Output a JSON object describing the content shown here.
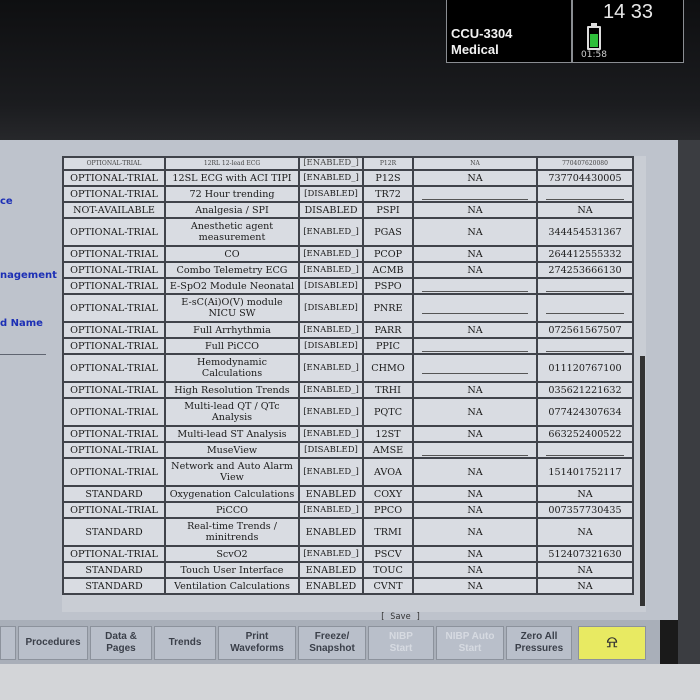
{
  "status": {
    "bed_label": "CCU-3304",
    "unit_label": "Medical",
    "time": "14 33",
    "battery_remaining": "01:58",
    "battery_color": "#2ebf3a"
  },
  "left_labels": [
    "ce",
    "nagement",
    "d Name"
  ],
  "options": [
    {
      "status": "OPTIONAL-TRIAL",
      "name": "12RL 12-lead ECG",
      "state": "[ENABLED_]",
      "code": "P12R",
      "tfa": "NA",
      "serial": "770407620080",
      "partial": true
    },
    {
      "status": "OPTIONAL-TRIAL",
      "name": "12SL ECG with ACI TIPI",
      "state": "[ENABLED_]",
      "code": "P12S",
      "tfa": "NA",
      "serial": "737704430005"
    },
    {
      "status": "OPTIONAL-TRIAL",
      "name": "72 Hour trending",
      "state": "[DISABLED]",
      "code": "TR72",
      "tfa": "",
      "serial": ""
    },
    {
      "status": "NOT-AVAILABLE",
      "name": "Analgesia / SPI",
      "state": "DISABLED",
      "code": "PSPI",
      "tfa": "NA",
      "serial": "NA"
    },
    {
      "status": "OPTIONAL-TRIAL",
      "name": "Anesthetic agent measurement",
      "state": "[ENABLED_]",
      "code": "PGAS",
      "tfa": "NA",
      "serial": "344454531367",
      "tall": true
    },
    {
      "status": "OPTIONAL-TRIAL",
      "name": "CO",
      "state": "[ENABLED_]",
      "code": "PCOP",
      "tfa": "NA",
      "serial": "264412555332"
    },
    {
      "status": "OPTIONAL-TRIAL",
      "name": "Combo Telemetry ECG",
      "state": "[ENABLED_]",
      "code": "ACMB",
      "tfa": "NA",
      "serial": "274253666130"
    },
    {
      "status": "OPTIONAL-TRIAL",
      "name": "E-SpO2 Module Neonatal",
      "state": "[DISABLED]",
      "code": "PSPO",
      "tfa": "",
      "serial": ""
    },
    {
      "status": "OPTIONAL-TRIAL",
      "name": "E-sC(Ai)O(V) module NICU SW",
      "state": "[DISABLED]",
      "code": "PNRE",
      "tfa": "",
      "serial": "",
      "tall": true
    },
    {
      "status": "OPTIONAL-TRIAL",
      "name": "Full Arrhythmia",
      "state": "[ENABLED_]",
      "code": "PARR",
      "tfa": "NA",
      "serial": "072561567507"
    },
    {
      "status": "OPTIONAL-TRIAL",
      "name": "Full PiCCO",
      "state": "[DISABLED]",
      "code": "PPIC",
      "tfa": "",
      "serial": ""
    },
    {
      "status": "OPTIONAL-TRIAL",
      "name": "Hemodynamic Calculations",
      "state": "[ENABLED_]",
      "code": "CHMO",
      "tfa": "",
      "serial": "011120767100",
      "tall": true
    },
    {
      "status": "OPTIONAL-TRIAL",
      "name": "High Resolution Trends",
      "state": "[ENABLED_]",
      "code": "TRHI",
      "tfa": "NA",
      "serial": "035621221632"
    },
    {
      "status": "OPTIONAL-TRIAL",
      "name": "Multi-lead QT / QTc Analysis",
      "state": "[ENABLED_]",
      "code": "PQTC",
      "tfa": "NA",
      "serial": "077424307634",
      "tall": true
    },
    {
      "status": "OPTIONAL-TRIAL",
      "name": "Multi-lead ST Analysis",
      "state": "[ENABLED_]",
      "code": "12ST",
      "tfa": "NA",
      "serial": "663252400522"
    },
    {
      "status": "OPTIONAL-TRIAL",
      "name": "MuseView",
      "state": "[DISABLED]",
      "code": "AMSE",
      "tfa": "",
      "serial": ""
    },
    {
      "status": "OPTIONAL-TRIAL",
      "name": "Network and Auto Alarm View",
      "state": "[ENABLED_]",
      "code": "AVOA",
      "tfa": "NA",
      "serial": "151401752117",
      "tall": true
    },
    {
      "status": "STANDARD",
      "name": "Oxygenation Calculations",
      "state": "ENABLED",
      "code": "COXY",
      "tfa": "NA",
      "serial": "NA"
    },
    {
      "status": "OPTIONAL-TRIAL",
      "name": "PiCCO",
      "state": "[ENABLED_]",
      "code": "PPCO",
      "tfa": "NA",
      "serial": "007357730435"
    },
    {
      "status": "STANDARD",
      "name": "Real-time Trends / minitrends",
      "state": "ENABLED",
      "code": "TRMI",
      "tfa": "NA",
      "serial": "NA",
      "tall": true
    },
    {
      "status": "OPTIONAL-TRIAL",
      "name": "ScvO2",
      "state": "[ENABLED_]",
      "code": "PSCV",
      "tfa": "NA",
      "serial": "512407321630"
    },
    {
      "status": "STANDARD",
      "name": "Touch User Interface",
      "state": "ENABLED",
      "code": "TOUC",
      "tfa": "NA",
      "serial": "NA"
    },
    {
      "status": "STANDARD",
      "name": "Ventilation Calculations",
      "state": "ENABLED",
      "code": "CVNT",
      "tfa": "NA",
      "serial": "NA"
    }
  ],
  "save_label": "[ Save ]",
  "toolbar": [
    {
      "label": "",
      "enabled": true
    },
    {
      "label": "Procedures",
      "enabled": true
    },
    {
      "label": "Data &\nPages",
      "enabled": true
    },
    {
      "label": "Trends",
      "enabled": true
    },
    {
      "label": "Print\nWaveforms",
      "enabled": true
    },
    {
      "label": "Freeze/\nSnapshot",
      "enabled": true
    },
    {
      "label": "NIBP\nStart",
      "enabled": false
    },
    {
      "label": "NIBP Auto\nStart",
      "enabled": false
    },
    {
      "label": "Zero All\nPressures",
      "enabled": true
    }
  ],
  "alarm_icon": "alarm-bell-icon",
  "alarm_color": "#e8ea62"
}
